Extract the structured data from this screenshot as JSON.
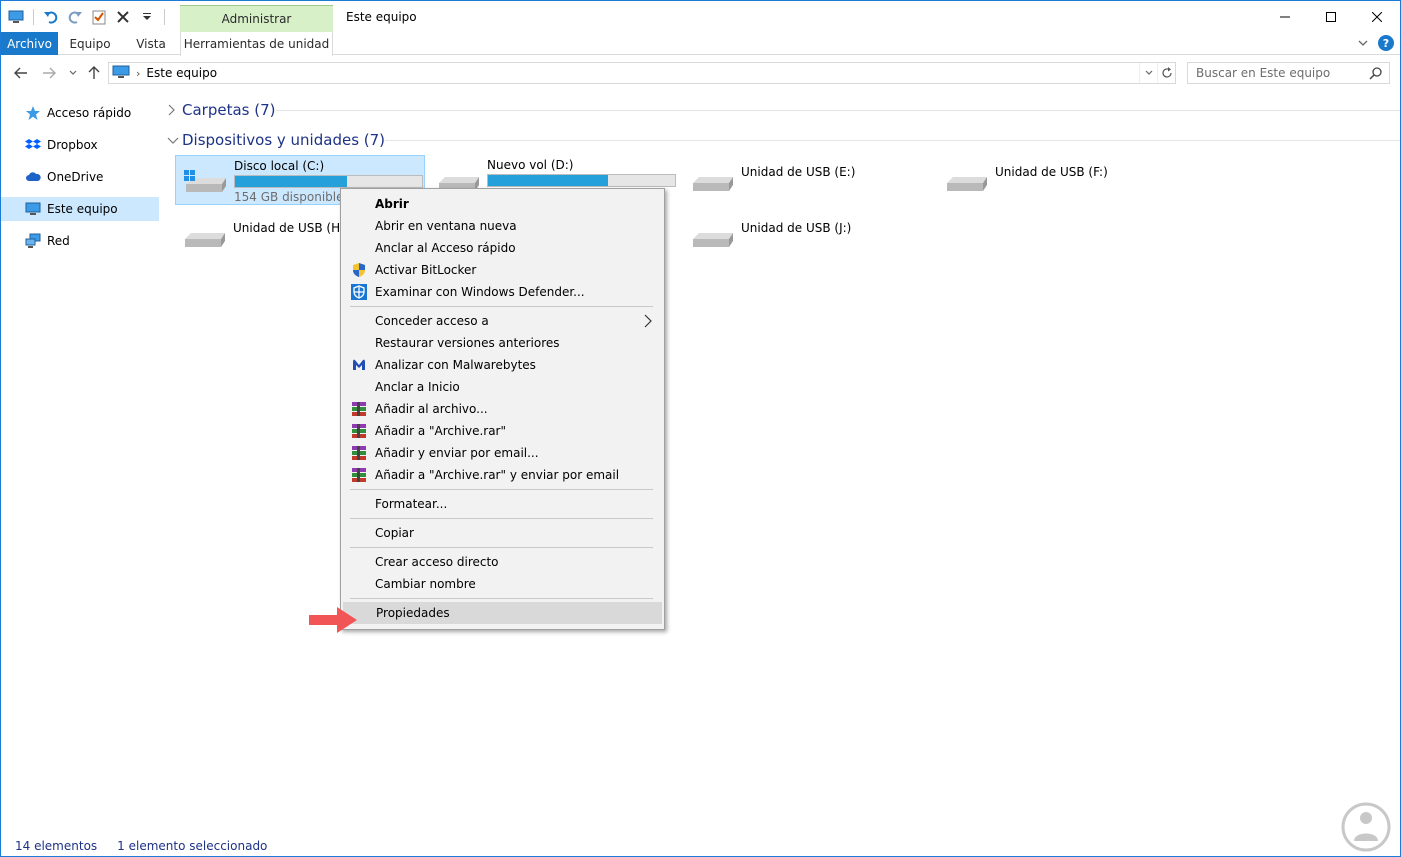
{
  "window": {
    "title": "Este equipo",
    "context_tab_group": "Administrar"
  },
  "ribbon": {
    "tabs": {
      "file": "Archivo",
      "equipo": "Equipo",
      "vista": "Vista",
      "herramientas": "Herramientas de unidad"
    }
  },
  "nav": {
    "breadcrumb": "Este equipo",
    "search_placeholder": "Buscar en Este equipo"
  },
  "sidebar": {
    "items": [
      {
        "label": "Acceso rápido",
        "icon": "star-icon"
      },
      {
        "label": "Dropbox",
        "icon": "dropbox-icon"
      },
      {
        "label": "OneDrive",
        "icon": "cloud-icon"
      },
      {
        "label": "Este equipo",
        "icon": "computer-icon",
        "selected": true
      },
      {
        "label": "Red",
        "icon": "network-icon"
      }
    ]
  },
  "groups": {
    "folders": "Carpetas (7)",
    "devices": "Dispositivos y unidades (7)"
  },
  "drives": [
    {
      "name": "Disco local (C:)",
      "free": "154 GB disponibles de",
      "used_fraction": 0.6,
      "selected": true
    },
    {
      "name": "Nuevo vol (D:)",
      "used_fraction": 0.64
    },
    {
      "name": "Unidad de USB (E:)"
    },
    {
      "name": "Unidad de USB (F:)"
    },
    {
      "name": "Unidad de USB (H:)"
    },
    {
      "name": "Unidad de USB (J:)"
    }
  ],
  "context_menu": {
    "items": [
      {
        "label": "Abrir",
        "bold": true
      },
      {
        "label": "Abrir en ventana nueva"
      },
      {
        "label": "Anclar al Acceso rápido"
      },
      {
        "label": "Activar BitLocker",
        "icon": "shield-uac-icon"
      },
      {
        "label": "Examinar con Windows Defender...",
        "icon": "windows-defender-icon"
      },
      {
        "label": "Conceder acceso a",
        "submenu": true
      },
      {
        "label": "Restaurar versiones anteriores"
      },
      {
        "label": "Analizar con Malwarebytes",
        "icon": "malwarebytes-icon"
      },
      {
        "label": "Anclar a Inicio"
      },
      {
        "label": "Añadir al archivo...",
        "icon": "winrar-icon"
      },
      {
        "label": "Añadir a \"Archive.rar\"",
        "icon": "winrar-icon"
      },
      {
        "label": "Añadir y enviar por email...",
        "icon": "winrar-icon"
      },
      {
        "label": "Añadir a \"Archive.rar\" y enviar por email",
        "icon": "winrar-icon"
      },
      {
        "label": "Formatear..."
      },
      {
        "label": "Copiar"
      },
      {
        "label": "Crear acceso directo"
      },
      {
        "label": "Cambiar nombre"
      },
      {
        "label": "Propiedades",
        "highlighted": true
      }
    ]
  },
  "status": {
    "count": "14 elementos",
    "selected": "1 elemento seleccionado"
  },
  "colors": {
    "accent": "#1979ca",
    "selection": "#cce8ff",
    "group_header": "#1e3287",
    "drive_bar": "#26a0da",
    "arrow": "#f25555"
  }
}
